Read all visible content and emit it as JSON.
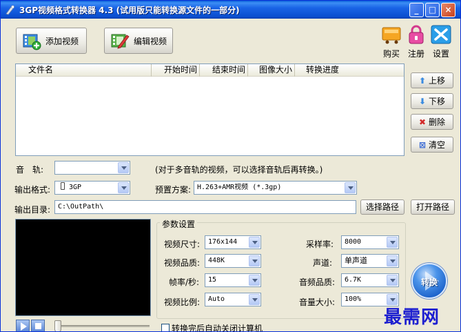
{
  "window": {
    "title": "3GP视频格式转换器 4.3 (试用版只能转换源文件的一部分)",
    "min": "_",
    "max": "□",
    "close": "×"
  },
  "toolbar": {
    "add_video": "添加视频",
    "edit_video": "编辑视频",
    "buy": "购买",
    "register": "注册",
    "settings": "设置"
  },
  "filelist": {
    "columns": [
      "文件名",
      "开始时间",
      "结束时间",
      "图像大小",
      "转换进度"
    ]
  },
  "side": {
    "up": "上移",
    "down": "下移",
    "delete": "删除",
    "clear": "清空"
  },
  "audio_track": {
    "label": "音　轨:",
    "value": "",
    "hint": "(对于多音轨的视频，可以选择音轨后再转换。)"
  },
  "output_format": {
    "label": "输出格式:",
    "value": "3GP"
  },
  "preset": {
    "label": "预置方案:",
    "value": "H.263+AMR视频 (*.3gp)"
  },
  "output_dir": {
    "label": "输出目录:",
    "value": "C:\\OutPath\\",
    "choose": "选择路径",
    "open": "打开路径"
  },
  "params": {
    "title": "参数设置",
    "video_size": {
      "label": "视频尺寸:",
      "value": "176x144"
    },
    "video_quality": {
      "label": "视频品质:",
      "value": "448K"
    },
    "frame_rate": {
      "label": "帧率/秒:",
      "value": "15"
    },
    "aspect_ratio": {
      "label": "视频比例:",
      "value": "Auto"
    },
    "sample_rate": {
      "label": "采样率:",
      "value": "8000"
    },
    "channel": {
      "label": "声道:",
      "value": "单声道"
    },
    "audio_quality": {
      "label": "音频品质:",
      "value": "6.7K"
    },
    "volume": {
      "label": "音量大小:",
      "value": "100%"
    }
  },
  "convert": {
    "label": "转换"
  },
  "shutdown": {
    "label": "转换完后自动关闭计算机",
    "checked": false
  },
  "watermark": "最需网",
  "colors": {
    "titlebar": "#0a4fd0",
    "face": "#ece9d8",
    "watermark": "#1d1fd0"
  }
}
